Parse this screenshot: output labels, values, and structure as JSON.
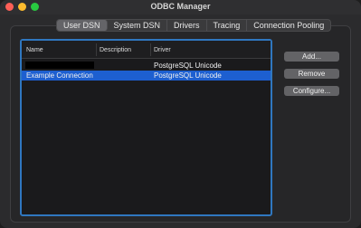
{
  "window": {
    "title": "ODBC Manager"
  },
  "tabs": [
    {
      "label": "User DSN",
      "active": true
    },
    {
      "label": "System DSN",
      "active": false
    },
    {
      "label": "Drivers",
      "active": false
    },
    {
      "label": "Tracing",
      "active": false
    },
    {
      "label": "Connection Pooling",
      "active": false
    }
  ],
  "table": {
    "columns": [
      "Name",
      "Description",
      "Driver"
    ],
    "rows": [
      {
        "name": "",
        "name_redacted": true,
        "description": "",
        "driver": "PostgreSQL Unicode",
        "selected": false
      },
      {
        "name": "Example Connection",
        "name_redacted": false,
        "description": "",
        "driver": "PostgreSQL Unicode",
        "selected": true
      }
    ]
  },
  "buttons": {
    "add": "Add...",
    "remove": "Remove",
    "configure": "Configure..."
  },
  "colors": {
    "selection": "#1d5fd0",
    "focus_ring": "#2f77c0",
    "close": "#fe5f57",
    "minimize": "#febc2e",
    "maximize": "#28c840"
  }
}
